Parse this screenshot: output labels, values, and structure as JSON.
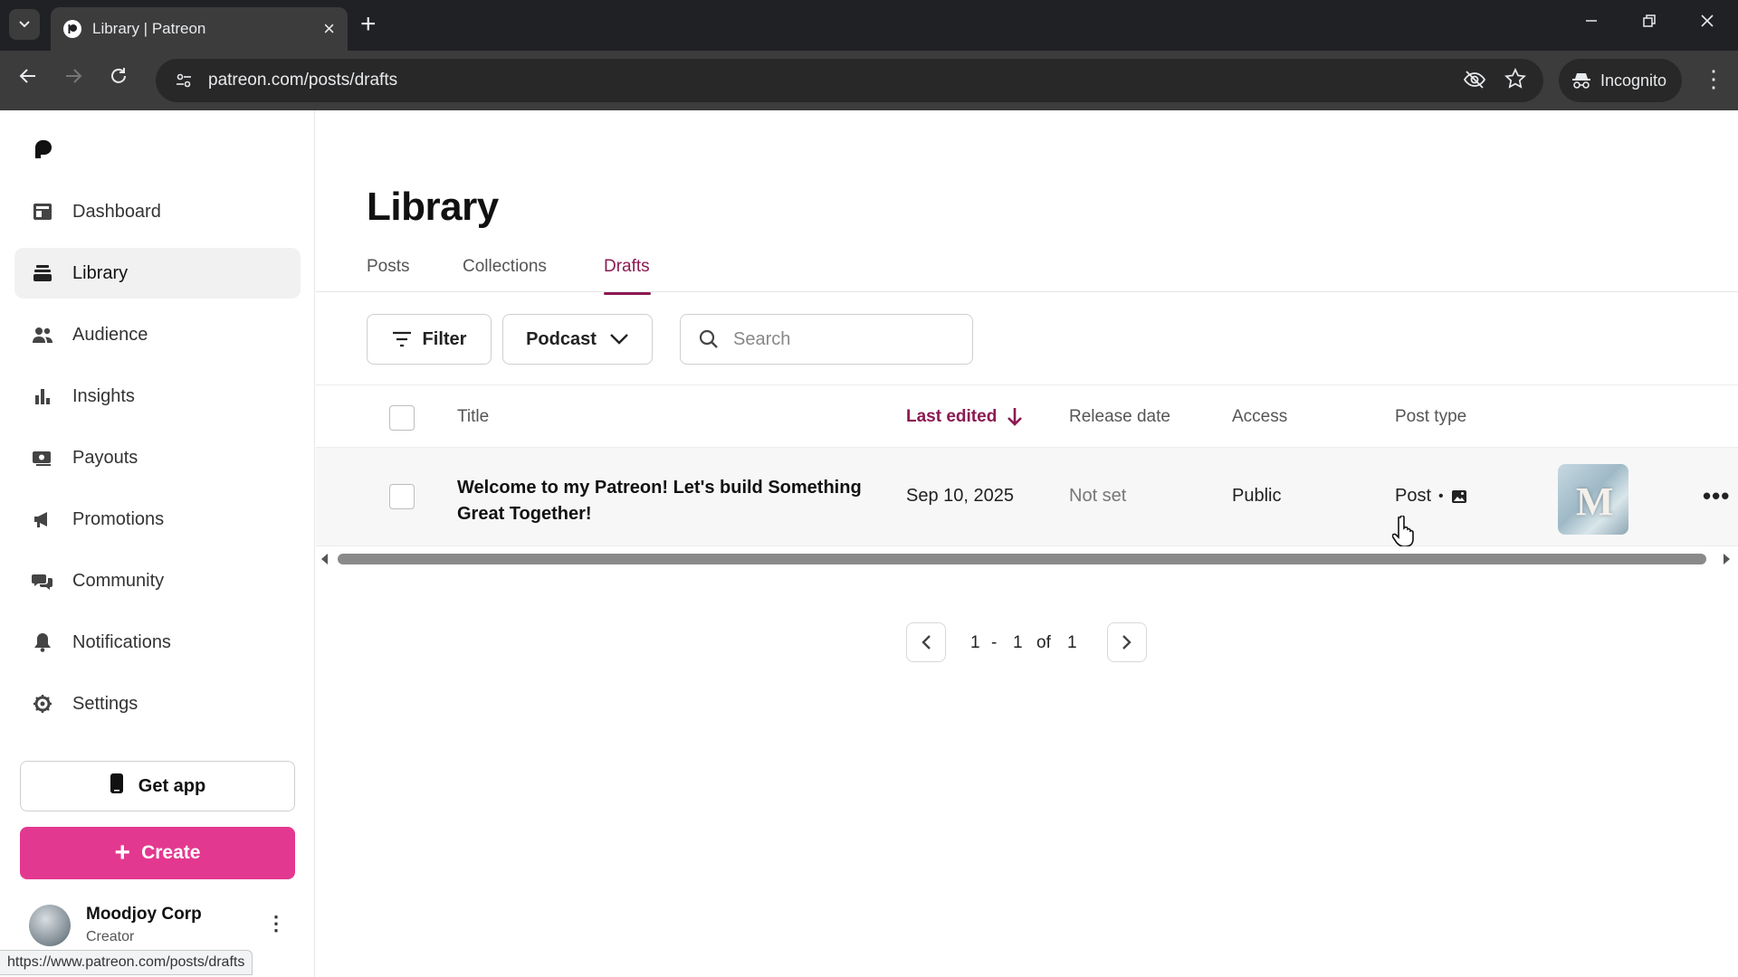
{
  "browser": {
    "tab_title": "Library | Patreon",
    "url": "patreon.com/posts/drafts",
    "incognito_label": "Incognito",
    "status_url": "https://www.patreon.com/posts/drafts"
  },
  "sidebar": {
    "items": [
      {
        "label": "Dashboard",
        "icon": "dashboard-icon"
      },
      {
        "label": "Library",
        "icon": "library-icon",
        "active": true
      },
      {
        "label": "Audience",
        "icon": "audience-icon"
      },
      {
        "label": "Insights",
        "icon": "insights-icon"
      },
      {
        "label": "Payouts",
        "icon": "payouts-icon"
      },
      {
        "label": "Promotions",
        "icon": "megaphone-icon"
      },
      {
        "label": "Community",
        "icon": "community-icon"
      },
      {
        "label": "Notifications",
        "icon": "bell-icon"
      },
      {
        "label": "Settings",
        "icon": "gear-icon"
      }
    ],
    "get_app_label": "Get app",
    "create_label": "Create",
    "profile": {
      "name": "Moodjoy Corp",
      "role": "Creator"
    }
  },
  "main": {
    "title": "Library",
    "tabs": [
      {
        "label": "Posts"
      },
      {
        "label": "Collections"
      },
      {
        "label": "Drafts",
        "active": true
      }
    ],
    "filter_label": "Filter",
    "type_dropdown_value": "Podcast",
    "search_placeholder": "Search",
    "table": {
      "columns": [
        "Title",
        "Last edited",
        "Release date",
        "Access",
        "Post type"
      ],
      "sorted_column": "Last edited",
      "rows": [
        {
          "title": "Welcome to my Patreon! Let's build Something Great Together!",
          "last_edited": "Sep 10, 2025",
          "release_date": "Not set",
          "access": "Public",
          "post_type": "Post",
          "post_type_icon": "image-icon"
        }
      ]
    },
    "pagination": {
      "start": "1",
      "separator": "-",
      "end": "1",
      "of_label": "of",
      "total": "1"
    }
  },
  "colors": {
    "accent": "#8b1a52",
    "create_button": "#e3388f",
    "chrome_dark": "#202124",
    "chrome_toolbar": "#3c3c3c"
  }
}
